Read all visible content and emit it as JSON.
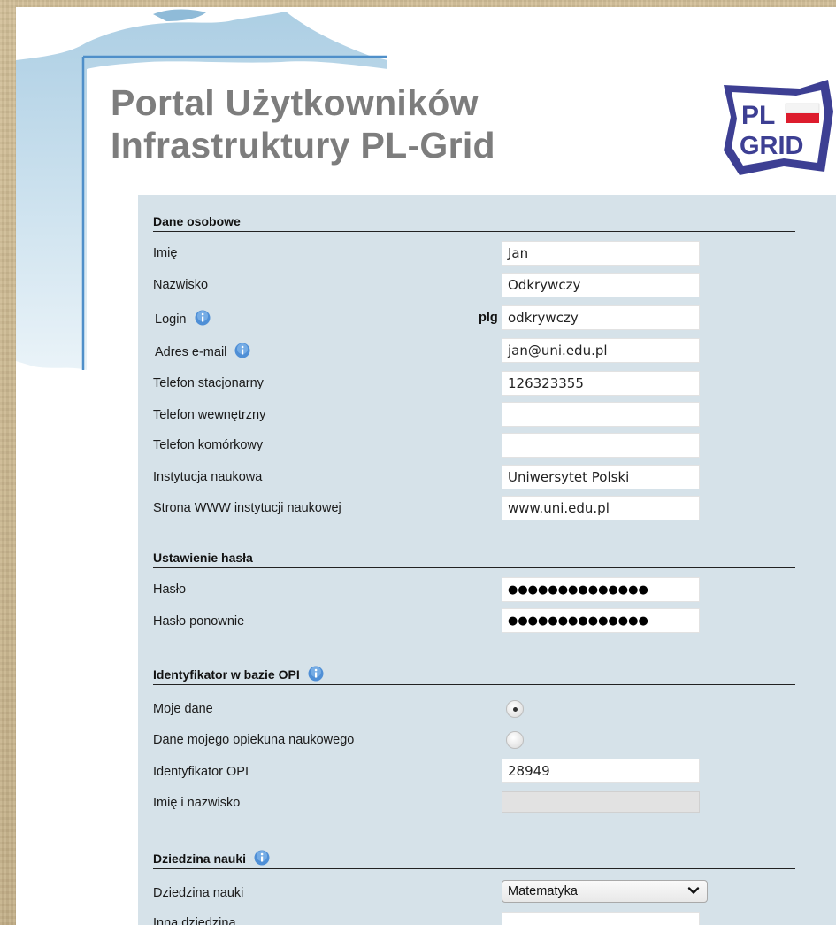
{
  "header": {
    "title_line1": "Portal Użytkowników",
    "title_line2": "Infrastruktury PL-Grid",
    "logo_top": "PL",
    "logo_bottom": "GRID"
  },
  "sections": {
    "personal": {
      "heading": "Dane osobowe",
      "first_name_label": "Imię",
      "first_name_value": "Jan",
      "last_name_label": "Nazwisko",
      "last_name_value": "Odkrywczy",
      "login_label": "Login",
      "login_prefix": "plg",
      "login_value": "odkrywczy",
      "email_label": "Adres e-mail",
      "email_value": "jan@uni.edu.pl",
      "phone_label": "Telefon stacjonarny",
      "phone_value": "126323355",
      "ext_label": "Telefon wewnętrzny",
      "ext_value": "",
      "mobile_label": "Telefon komórkowy",
      "mobile_value": "",
      "institution_label": "Instytucja naukowa",
      "institution_value": "Uniwersytet Polski",
      "www_label": "Strona WWW instytucji naukowej",
      "www_value": "www.uni.edu.pl"
    },
    "password": {
      "heading": "Ustawienie hasła",
      "password_label": "Hasło",
      "password_value": "●●●●●●●●●●●●●●",
      "password_repeat_label": "Hasło ponownie",
      "password_repeat_value": "●●●●●●●●●●●●●●"
    },
    "opi": {
      "heading": "Identyfikator w bazie OPI",
      "my_data_label": "Moje dane",
      "supervisor_label": "Dane mojego opiekuna naukowego",
      "my_data_selected": true,
      "opi_id_label": "Identyfikator OPI",
      "opi_id_value": "28949",
      "full_name_label": "Imię i nazwisko",
      "full_name_value": ""
    },
    "science": {
      "heading": "Dziedzina nauki",
      "field_label": "Dziedzina nauki",
      "field_selected": "Matematyka",
      "other_label": "Inna dziedzina",
      "other_value": ""
    }
  },
  "colors": {
    "form_background": "#d6e2e9",
    "title_gray": "#7d7d7d",
    "map_blue": "#b5d3e6",
    "info_icon_blue": "#4f8fd6",
    "logo_blue": "#3d3f93",
    "flag_red": "#dd1c2d"
  },
  "icons": {
    "info": "info-icon",
    "select_arrow": "chevron-down-icon",
    "logo": "plgrid-logo"
  }
}
